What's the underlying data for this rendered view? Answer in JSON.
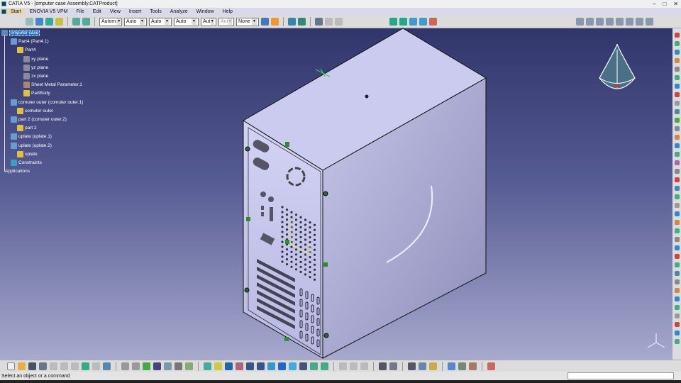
{
  "window": {
    "title": "CATIA V5 - [omputer case Assembly.CATProduct]",
    "minimize": "–",
    "maximize": "□",
    "close": "✕"
  },
  "menu": {
    "items": [
      "Start",
      "ENOVIA V5 VPM",
      "File",
      "Edit",
      "View",
      "Insert",
      "Tools",
      "Analyze",
      "Window",
      "Help"
    ]
  },
  "toolbar": {
    "selects": [
      "Autom:",
      "Auto",
      "Auto",
      "Auto",
      "Aut",
      "Aut",
      "None"
    ]
  },
  "tree": {
    "nodes": [
      {
        "label": "omputer case",
        "level": 0
      },
      {
        "label": "Part4 (Part4.1)",
        "level": 1
      },
      {
        "label": "Part4",
        "level": 2
      },
      {
        "label": "xy plane",
        "level": 3
      },
      {
        "label": "yz plane",
        "level": 3
      },
      {
        "label": "zx plane",
        "level": 3
      },
      {
        "label": "Sheet Metal Parameter.1",
        "level": 3
      },
      {
        "label": "PartBody",
        "level": 3
      },
      {
        "label": "comuter outer (comuter outer.1)",
        "level": 1
      },
      {
        "label": "comuter outer",
        "level": 2
      },
      {
        "label": "part 2 (comuter outer.2)",
        "level": 1
      },
      {
        "label": "part 2",
        "level": 2
      },
      {
        "label": "uplate (uplate.1)",
        "level": 1
      },
      {
        "label": "uplate (uplate.2)",
        "level": 1
      },
      {
        "label": "uplate",
        "level": 2
      },
      {
        "label": "Constraints",
        "level": 1
      },
      {
        "label": "Applications",
        "level": 0
      }
    ]
  },
  "status": {
    "text": "Select an object or a command"
  },
  "colors": {
    "viewport_top": "#30356a",
    "viewport_bottom": "#a7a9cd",
    "selection": "#2a6fd0"
  }
}
